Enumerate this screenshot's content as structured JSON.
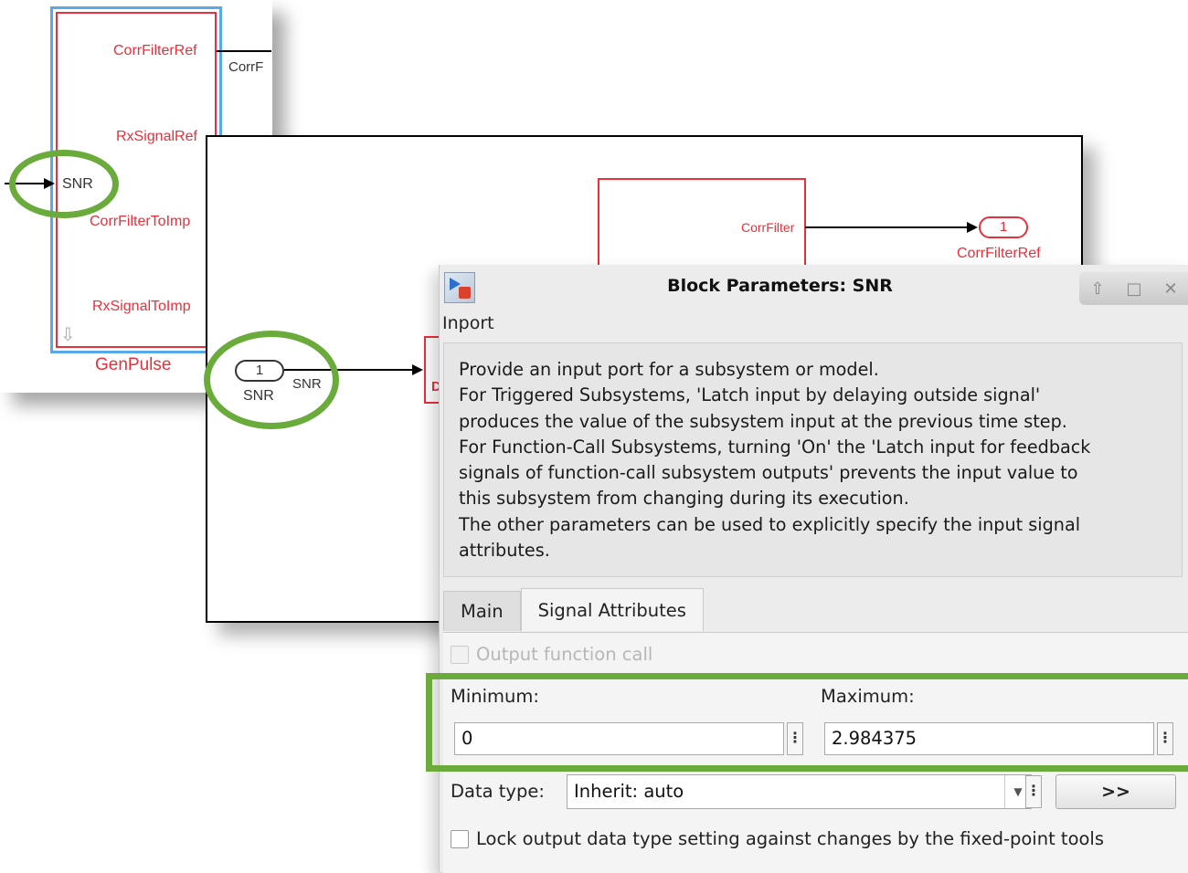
{
  "genpulse": {
    "block_name": "GenPulse",
    "ports": {
      "corr_filter_ref": "CorrFilterRef",
      "rx_signal_ref": "RxSignalRef",
      "snr": "SNR",
      "corr_filter_to_imp": "CorrFilterToImp",
      "rx_signal_to_imp": "RxSignalToImp"
    },
    "output_signal_partial": "CorrF"
  },
  "subsystem": {
    "corr_filter_port": "CorrFilter",
    "outport_number": "1",
    "outport_name": "CorrFilterRef",
    "inport_number": "1",
    "inport_name": "SNR",
    "signal_label": "SNR",
    "partial_block_text": "D"
  },
  "dialog": {
    "title": "Block Parameters: SNR",
    "block_type": "Inport",
    "window_buttons": [
      "⇧",
      "□",
      "✕"
    ],
    "description": [
      "Provide an input port for a subsystem or model.",
      "For Triggered Subsystems, 'Latch input by delaying outside signal'",
      "produces the value of the subsystem input at the previous time step.",
      "For Function-Call Subsystems, turning 'On' the 'Latch input for feedback",
      "signals of function-call subsystem outputs' prevents the input value to",
      "this subsystem from changing during its execution.",
      "The other parameters can be used to explicitly specify the input signal",
      "attributes."
    ],
    "tabs": [
      {
        "label": "Main",
        "active": false
      },
      {
        "label": "Signal Attributes",
        "active": true
      }
    ],
    "output_function_call": {
      "label": "Output function call",
      "checked": false,
      "enabled": false
    },
    "minimum": {
      "label": "Minimum:",
      "value": "0"
    },
    "maximum": {
      "label": "Maximum:",
      "value": "2.984375"
    },
    "data_type": {
      "label": "Data type:",
      "value": "Inherit: auto",
      "assistant_button": ">>"
    },
    "lock_output": {
      "label": "Lock output data type setting against changes by the fixed-point tools",
      "checked": false
    }
  },
  "colors": {
    "highlight": "#6aab3b",
    "block_red": "#e8303c",
    "selection_blue": "#58a9ea"
  }
}
